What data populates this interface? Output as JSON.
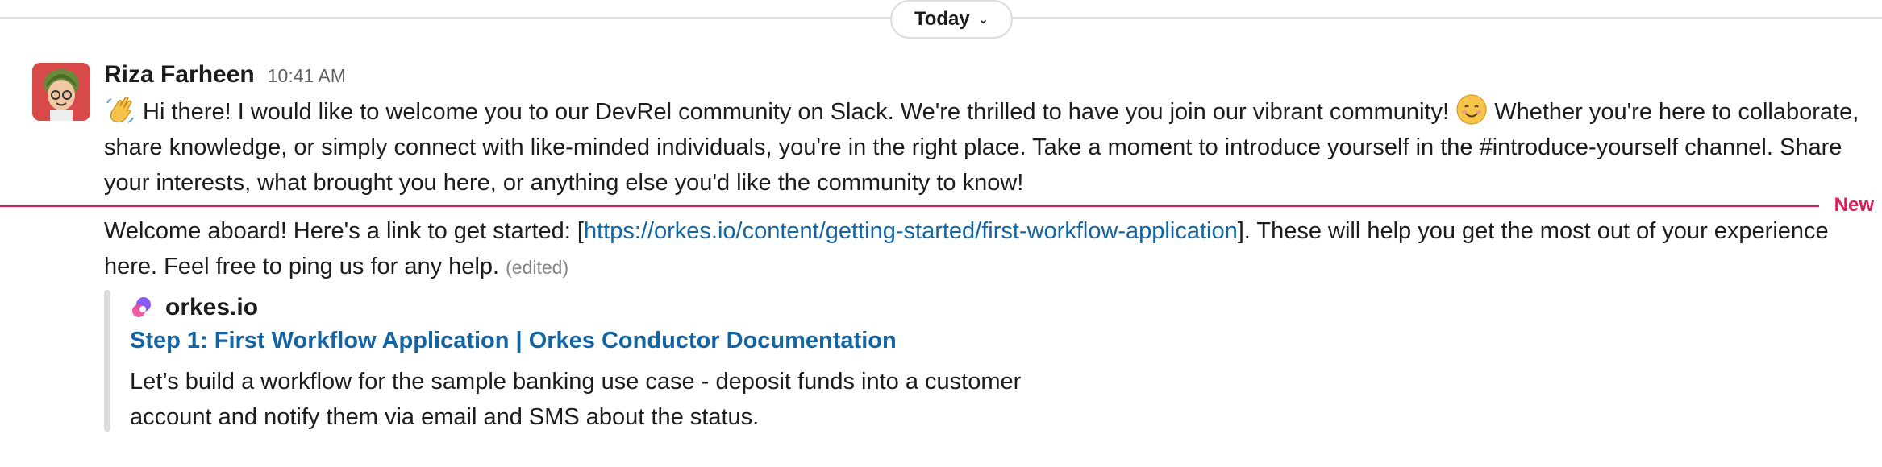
{
  "day_divider": {
    "label": "Today"
  },
  "message": {
    "sender": "Riza Farheen",
    "time": "10:41 AM",
    "part1_before_emoji": " Hi there!  I would like to welcome you to our DevRel community on Slack.  We're thrilled to have you join our vibrant community! ",
    "part1_after_emoji": " Whether you're here to collaborate, share knowledge, or simply connect with like-minded individuals, you're in the right place. Take a moment to introduce yourself in the #introduce-yourself channel. Share your interests, what brought you here, or anything else you'd like the community to know!",
    "part2_before_link": "Welcome aboard! Here's a link to get started: [",
    "link": "https://orkes.io/content/getting-started/first-workflow-application",
    "part2_after_link": "]. These will help you get the most out of your experience here. Feel free to ping  us for any help. ",
    "edited": "(edited)",
    "emojis": [
      "waving-hand",
      "smiling-face"
    ]
  },
  "new_divider": {
    "label": "New"
  },
  "unfurl": {
    "site": "orkes.io",
    "title": "Step 1: First Workflow Application | Orkes Conductor Documentation",
    "description": "Let’s build a workflow for the sample banking use case - deposit funds into a customer account and notify them via email and SMS about the status."
  },
  "colors": {
    "link": "#1264a3",
    "new": "#e01e5a",
    "avatar_bg": "#d84a4a"
  }
}
